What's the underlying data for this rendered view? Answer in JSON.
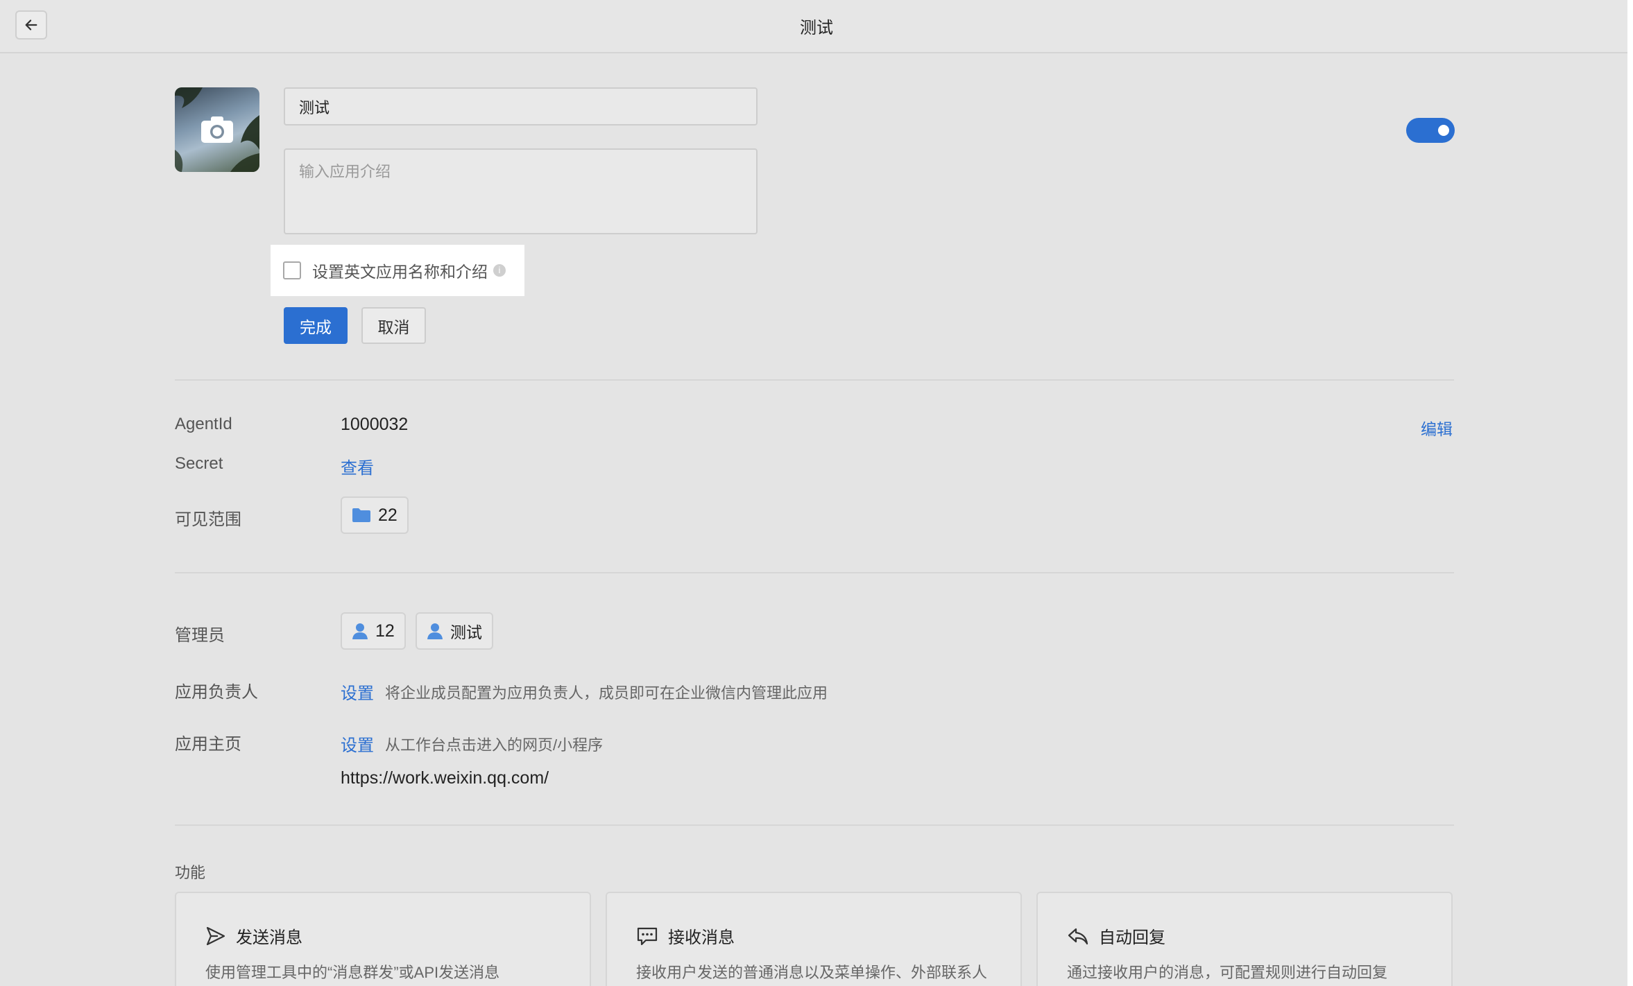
{
  "header": {
    "title": "测试"
  },
  "app": {
    "name_value": "测试",
    "desc_placeholder": "输入应用介绍",
    "en_checkbox_label": "设置英文应用名称和介绍",
    "info_glyph": "i",
    "done_label": "完成",
    "cancel_label": "取消",
    "enabled": true
  },
  "details": {
    "agentid_label": "AgentId",
    "agentid_value": "1000032",
    "edit_label": "编辑",
    "secret_label": "Secret",
    "secret_link": "查看",
    "scope_label": "可见范围",
    "scope_count": "22"
  },
  "admins": {
    "label": "管理员",
    "items": [
      "12",
      "测试"
    ]
  },
  "owner": {
    "label": "应用负责人",
    "link": "设置",
    "hint": "将企业成员配置为应用负责人，成员即可在企业微信内管理此应用"
  },
  "homepage": {
    "label": "应用主页",
    "link": "设置",
    "hint": "从工作台点击进入的网页/小程序",
    "url": "https://work.weixin.qq.com/"
  },
  "features": {
    "title": "功能",
    "cards": [
      {
        "title": "发送消息",
        "desc": "使用管理工具中的“消息群发”或API发送消息",
        "icon": "send-icon"
      },
      {
        "title": "接收消息",
        "desc": "接收用户发送的普通消息以及菜单操作、外部联系人",
        "icon": "chat-icon"
      },
      {
        "title": "自动回复",
        "desc": "通过接收用户的消息，可配置规则进行自动回复",
        "icon": "reply-icon"
      }
    ]
  },
  "colors": {
    "accent": "#2b6fd1",
    "background": "#e4e4e4"
  }
}
